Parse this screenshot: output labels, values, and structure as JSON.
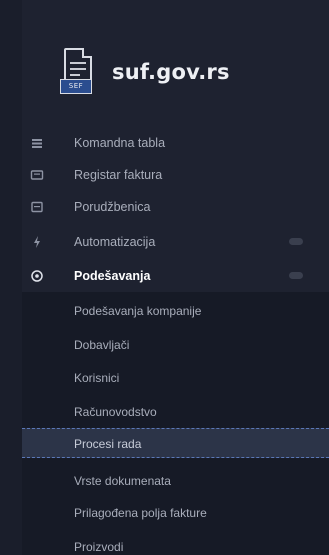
{
  "logo": {
    "text": "suf.gov.rs",
    "tag": "SEF"
  },
  "menu": [
    {
      "label": "Komandna tabla",
      "icon": "dashboard-icon"
    },
    {
      "label": "Registar faktura",
      "icon": "invoice-icon"
    },
    {
      "label": "Porudžbenica",
      "icon": "order-icon"
    },
    {
      "label": "Automatizacija",
      "icon": "lightning-icon"
    },
    {
      "label": "Podešavanja",
      "icon": "settings-icon"
    }
  ],
  "submenu": [
    {
      "label": "Podešavanja kompanije"
    },
    {
      "label": "Dobavljači"
    },
    {
      "label": "Korisnici"
    },
    {
      "label": "Računovodstvo"
    },
    {
      "label": "Procesi rada"
    },
    {
      "label": "Vrste dokumenata"
    },
    {
      "label": "Prilagođena polja fakture"
    },
    {
      "label": "Proizvodi"
    }
  ],
  "colors": {
    "background": "#1e2230",
    "submenu_background": "#161a26",
    "selected_background": "#2c3448",
    "selected_border": "#5b78b8"
  }
}
